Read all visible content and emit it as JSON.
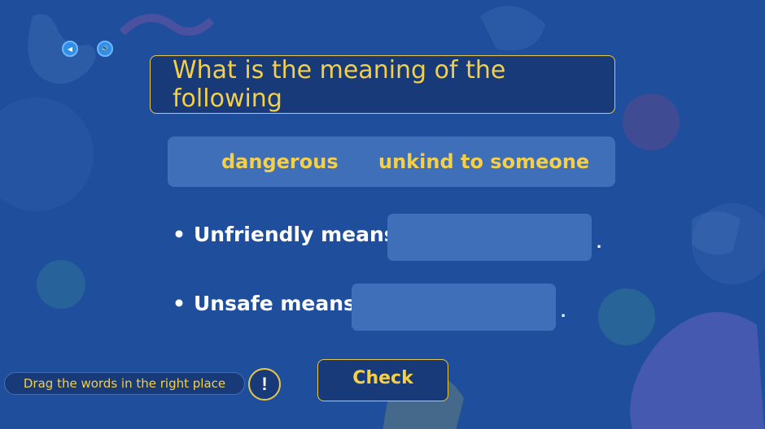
{
  "nav": {
    "back_icon": "◀",
    "audio_icon": "🔊"
  },
  "question": "What is the meaning of the following",
  "word_bank": [
    "dangerous",
    "unkind to someone"
  ],
  "sentences": [
    {
      "label": "Unfriendly means",
      "answer": "",
      "period": "."
    },
    {
      "label": "Unsafe means",
      "answer": "",
      "period": "."
    }
  ],
  "bullet": "•",
  "instruction": "Drag the words in the right place",
  "hint_symbol": "!",
  "check_label": "Check",
  "colors": {
    "background": "#1f4f9c",
    "accent": "#f3cf4a",
    "panel": "#3f6fb8",
    "dark": "#183a78"
  }
}
